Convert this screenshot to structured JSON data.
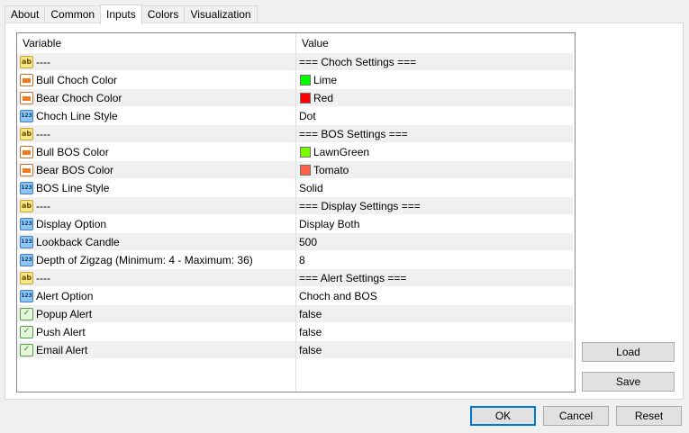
{
  "tabs": [
    "About",
    "Common",
    "Inputs",
    "Colors",
    "Visualization"
  ],
  "active_tab": "Inputs",
  "grid": {
    "columns": [
      "Variable",
      "Value"
    ],
    "rows": [
      {
        "type": "string",
        "variable": "----",
        "value": "=== Choch Settings ==="
      },
      {
        "type": "color",
        "variable": "Bull Choch Color",
        "value": "Lime",
        "swatch": "#00ff00"
      },
      {
        "type": "color",
        "variable": "Bear Choch Color",
        "value": "Red",
        "swatch": "#ff0000"
      },
      {
        "type": "enum",
        "variable": "Choch Line Style",
        "value": "Dot"
      },
      {
        "type": "string",
        "variable": "----",
        "value": "=== BOS Settings ==="
      },
      {
        "type": "color",
        "variable": "Bull BOS Color",
        "value": "LawnGreen",
        "swatch": "#7cfc00"
      },
      {
        "type": "color",
        "variable": "Bear BOS Color",
        "value": "Tomato",
        "swatch": "#ff6347"
      },
      {
        "type": "enum",
        "variable": "BOS Line Style",
        "value": "Solid"
      },
      {
        "type": "string",
        "variable": "----",
        "value": "=== Display Settings ==="
      },
      {
        "type": "enum",
        "variable": "Display Option",
        "value": "Display Both"
      },
      {
        "type": "int",
        "variable": "Lookback Candle",
        "value": "500"
      },
      {
        "type": "int",
        "variable": "Depth of Zigzag (Minimum: 4  -  Maximum: 36)",
        "value": "8"
      },
      {
        "type": "string",
        "variable": "----",
        "value": "=== Alert Settings ==="
      },
      {
        "type": "enum",
        "variable": "Alert Option",
        "value": "Choch and BOS"
      },
      {
        "type": "bool",
        "variable": "Popup Alert",
        "value": "false"
      },
      {
        "type": "bool",
        "variable": "Push Alert",
        "value": "false"
      },
      {
        "type": "bool",
        "variable": "Email Alert",
        "value": "false"
      }
    ]
  },
  "side_buttons": {
    "load": "Load",
    "save": "Save"
  },
  "footer_buttons": {
    "ok": "OK",
    "cancel": "Cancel",
    "reset": "Reset"
  },
  "icons": {
    "string": "ab-string-icon",
    "color": "color-palette-icon",
    "enum": "123-number-icon",
    "int": "123-number-icon",
    "bool": "boolean-check-icon"
  }
}
